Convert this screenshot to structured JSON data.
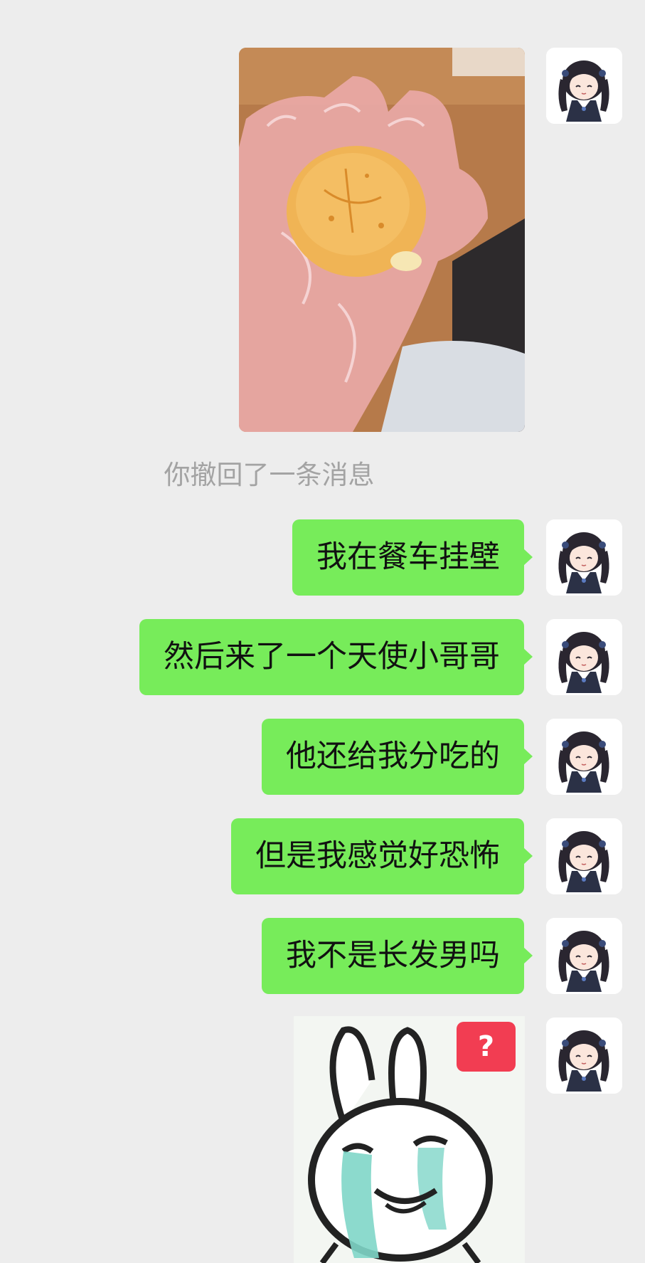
{
  "chat": {
    "recall_notice": "你撤回了一条消息",
    "messages": [
      {
        "text": "我在餐车挂壁"
      },
      {
        "text": "然后来了一个天使小哥哥"
      },
      {
        "text": "他还给我分吃的"
      },
      {
        "text": "但是我感觉好恐怖"
      },
      {
        "text": "我不是长发男吗"
      }
    ],
    "sticker": {
      "badge": "?"
    }
  },
  "colors": {
    "background": "#ededed",
    "sent_bubble": "#77ec5a",
    "recall_text": "#a3a3a3",
    "badge": "#f23d52"
  },
  "icons": {
    "avatar": "anime-girl-avatar-icon",
    "photo": "bread-in-gloved-hand-photo",
    "sticker": "crying-rabbit-sticker"
  }
}
